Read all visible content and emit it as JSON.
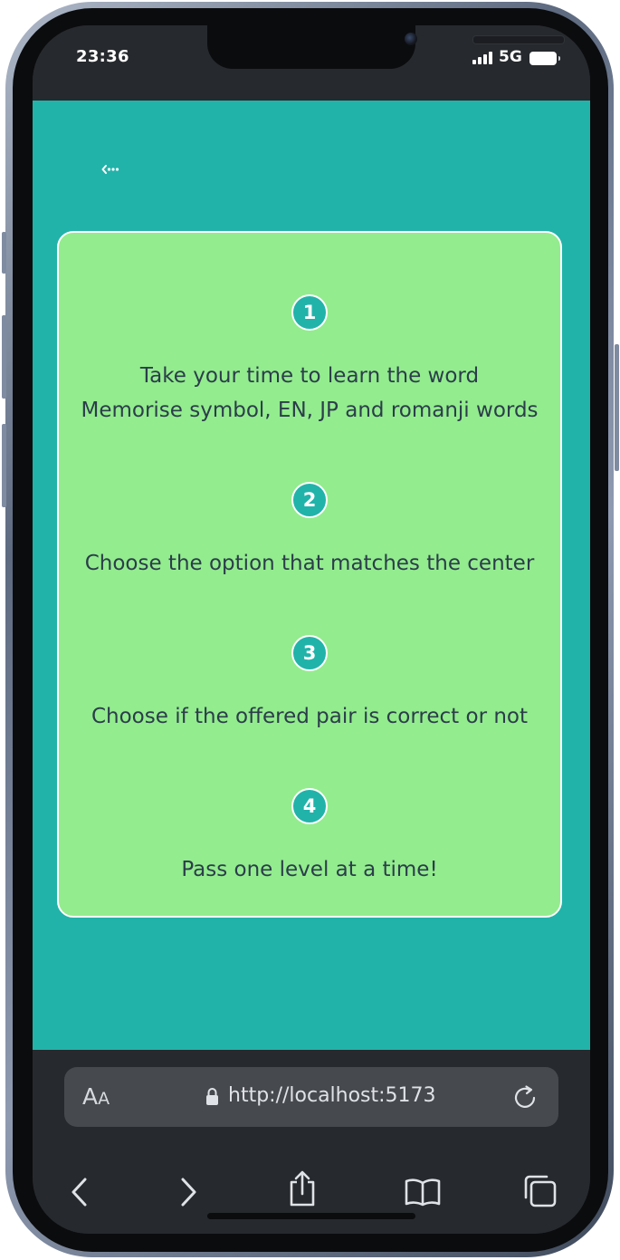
{
  "status_bar": {
    "time": "23:36",
    "network": "5G"
  },
  "page": {
    "background_color": "#21b3aa",
    "back_icon": "back-arrow-icon",
    "card_color": "#93ec8e",
    "steps": [
      {
        "number": "1",
        "lines": [
          "Take your time to learn the word",
          "Memorise symbol, EN, JP and romanji words"
        ]
      },
      {
        "number": "2",
        "lines": [
          "Choose the option that matches the center"
        ]
      },
      {
        "number": "3",
        "lines": [
          "Choose if the offered pair is correct or not"
        ]
      },
      {
        "number": "4",
        "lines": [
          "Pass one level at a time!"
        ]
      }
    ]
  },
  "browser": {
    "text_size_big": "A",
    "text_size_small": "A",
    "url": "http://localhost:5173",
    "icons": [
      "lock-icon",
      "reload-icon",
      "back-icon",
      "forward-icon",
      "share-icon",
      "bookmarks-icon",
      "tabs-icon"
    ]
  }
}
